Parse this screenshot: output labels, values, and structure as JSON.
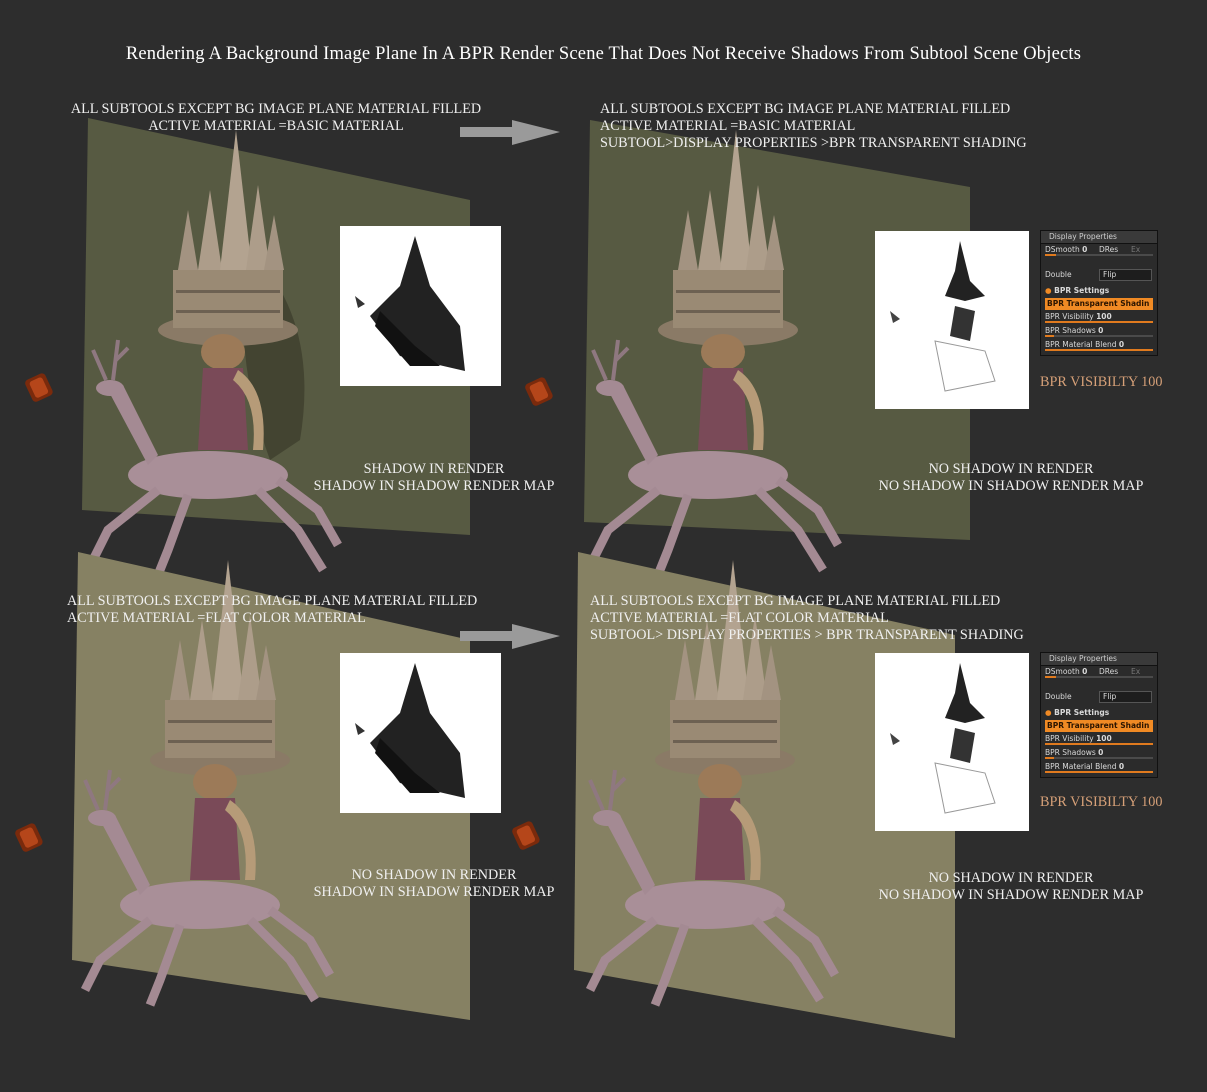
{
  "title": "Rendering A Background Image Plane In A BPR Render Scene That Does Not Receive Shadows From Subtool Scene Objects",
  "colors": {
    "background": "#2d2d2d",
    "plane_dark": "#575a42",
    "plane_light": "#868163",
    "accent": "#f08a24",
    "orange_label": "#d6a078"
  },
  "quadrants": {
    "tl": {
      "lines": [
        "ALL SUBTOOLS EXCEPT BG IMAGE PLANE MATERIAL FILLED",
        "ACTIVE MATERIAL =BASIC MATERIAL"
      ],
      "result": [
        "SHADOW IN RENDER",
        "SHADOW IN SHADOW RENDER MAP"
      ]
    },
    "tr": {
      "lines": [
        "ALL SUBTOOLS EXCEPT BG IMAGE PLANE MATERIAL FILLED",
        "ACTIVE MATERIAL =BASIC MATERIAL",
        "SUBTOOL>DISPLAY PROPERTIES >BPR TRANSPARENT SHADING"
      ],
      "result": [
        "NO SHADOW IN RENDER",
        "NO SHADOW IN SHADOW RENDER MAP"
      ],
      "visibility_label": "BPR VISIBILTY 100"
    },
    "bl": {
      "lines": [
        "ALL SUBTOOLS EXCEPT BG IMAGE PLANE MATERIAL FILLED",
        "ACTIVE MATERIAL =FLAT COLOR MATERIAL"
      ],
      "result": [
        "NO SHADOW IN RENDER",
        "SHADOW IN SHADOW RENDER MAP"
      ]
    },
    "br": {
      "lines": [
        "ALL SUBTOOLS EXCEPT BG IMAGE PLANE MATERIAL FILLED",
        "ACTIVE MATERIAL =FLAT COLOR MATERIAL",
        "SUBTOOL> DISPLAY PROPERTIES > BPR TRANSPARENT SHADING"
      ],
      "result": [
        "NO SHADOW IN RENDER",
        "NO SHADOW IN SHADOW RENDER MAP"
      ],
      "visibility_label": "BPR VISIBILTY 100"
    }
  },
  "display_panel": {
    "title": "Display Properties",
    "dsmooth_label": "DSmooth",
    "dsmooth_value": "0",
    "dres_label": "DRes",
    "dres_extra": "Ex",
    "double_label": "Double",
    "flip_label": "Flip",
    "bpr_settings_label": "BPR Settings",
    "transparent_label": "BPR Transparent Shadin",
    "visibility_label": "BPR Visibility",
    "visibility_value": "100",
    "shadows_label": "BPR Shadows",
    "shadows_value": "0",
    "blend_label": "BPR Material Blend",
    "blend_value": "0",
    "visibility_fill": 1.0,
    "blend_fill": 1.0
  }
}
